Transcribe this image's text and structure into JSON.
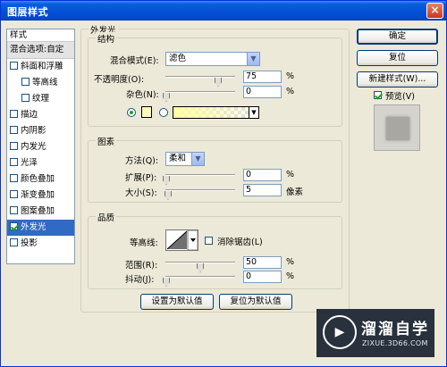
{
  "window": {
    "title": "图层样式",
    "close_label": "×"
  },
  "styles_panel": {
    "header": "样式",
    "blend_item": "混合选项:自定",
    "items": [
      {
        "label": "斜面和浮雕",
        "checked": false,
        "indent": false
      },
      {
        "label": "等高线",
        "checked": false,
        "indent": true
      },
      {
        "label": "纹理",
        "checked": false,
        "indent": true
      },
      {
        "label": "描边",
        "checked": false,
        "indent": false
      },
      {
        "label": "内阴影",
        "checked": false,
        "indent": false
      },
      {
        "label": "内发光",
        "checked": false,
        "indent": false
      },
      {
        "label": "光泽",
        "checked": false,
        "indent": false
      },
      {
        "label": "颜色叠加",
        "checked": false,
        "indent": false
      },
      {
        "label": "渐变叠加",
        "checked": false,
        "indent": false
      },
      {
        "label": "图案叠加",
        "checked": false,
        "indent": false
      },
      {
        "label": "外发光",
        "checked": true,
        "indent": false,
        "selected": true
      },
      {
        "label": "投影",
        "checked": false,
        "indent": false
      }
    ]
  },
  "outer_glow": {
    "title": "外发光",
    "structure": {
      "title": "结构",
      "blend_mode_label": "混合模式(E):",
      "blend_mode_value": "滤色",
      "opacity_label": "不透明度(O):",
      "opacity_value": "75",
      "opacity_unit": "%",
      "noise_label": "杂色(N):",
      "noise_value": "0",
      "noise_unit": "%",
      "color_swatch": "#ffffbe"
    },
    "elements": {
      "title": "图素",
      "technique_label": "方法(Q):",
      "technique_value": "柔和",
      "spread_label": "扩展(P):",
      "spread_value": "0",
      "spread_unit": "%",
      "size_label": "大小(S):",
      "size_value": "5",
      "size_unit": "像素"
    },
    "quality": {
      "title": "品质",
      "contour_label": "等高线:",
      "antialias_label": "消除锯齿(L)",
      "range_label": "范围(R):",
      "range_value": "50",
      "range_unit": "%",
      "jitter_label": "抖动(J):",
      "jitter_value": "0",
      "jitter_unit": "%"
    },
    "make_default": "设置为默认值",
    "reset_default": "复位为默认值"
  },
  "side_buttons": {
    "ok": "确定",
    "reset": "复位",
    "new_style": "新建样式(W)...",
    "preview_label": "预览(V)"
  },
  "watermark": {
    "title": "溜溜自学",
    "url": "ZIXUE.3D66.COM",
    "logo": "▶"
  }
}
